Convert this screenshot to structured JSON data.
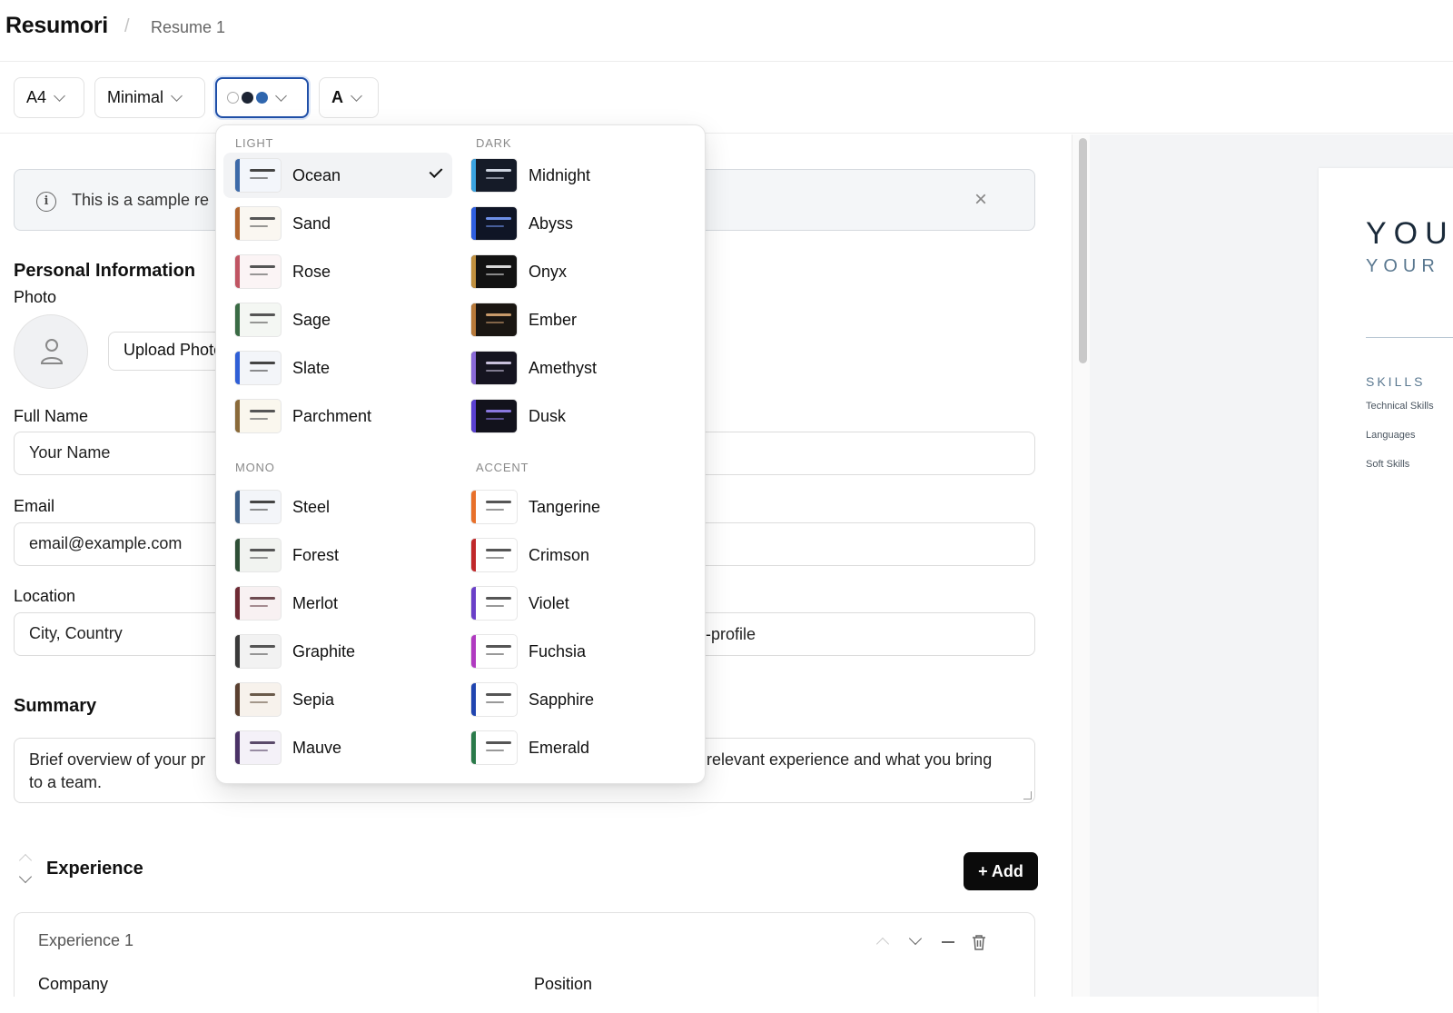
{
  "app": {
    "brand": "Resumori",
    "separator": "/",
    "breadcrumb": "Resume 1"
  },
  "toolbar": {
    "page_size": "A4",
    "template": "Minimal",
    "font_label": "A",
    "color_dots": [
      "#ffffff",
      "#1c2433",
      "#2f66ae"
    ]
  },
  "banner": {
    "text": "This is a sample re",
    "close": "×"
  },
  "personal": {
    "heading": "Personal Information",
    "photo_label": "Photo",
    "upload_label": "Upload Photo",
    "full_name_label": "Full Name",
    "full_name_placeholder": "Your Name",
    "email_label": "Email",
    "email_placeholder": "email@example.com",
    "location_label": "Location",
    "location_placeholder": "City, Country",
    "profile_tail": "-profile"
  },
  "summary": {
    "heading": "Summary",
    "placeholder_start": "Brief overview of your pr",
    "placeholder_end": "relevant experience and what you bring",
    "placeholder_line2": "to a team."
  },
  "experience": {
    "heading": "Experience",
    "add_label": "+ Add",
    "card_title": "Experience 1",
    "company_label": "Company",
    "position_label": "Position"
  },
  "preview": {
    "name": "YOU",
    "subtitle": "YOUR",
    "skills_heading": "SKILLS",
    "skill_items": [
      "Technical Skills",
      "Languages",
      "Soft Skills"
    ]
  },
  "themes": {
    "groups": {
      "light": "LIGHT",
      "dark": "DARK",
      "mono": "MONO",
      "accent": "ACCENT"
    },
    "selected": "Ocean",
    "light": [
      {
        "name": "Ocean",
        "bar": "#3d6aa8",
        "bg": "#f3f6fb",
        "line": "#444444"
      },
      {
        "name": "Sand",
        "bar": "#b0652f",
        "bg": "#faf7f1",
        "line": "#555555"
      },
      {
        "name": "Rose",
        "bar": "#c05563",
        "bg": "#fbf4f5",
        "line": "#555555"
      },
      {
        "name": "Sage",
        "bar": "#3a6b45",
        "bg": "#f4f7f3",
        "line": "#555555"
      },
      {
        "name": "Slate",
        "bar": "#2f5fd6",
        "bg": "#f3f5f9",
        "line": "#444444"
      },
      {
        "name": "Parchment",
        "bar": "#8a6a3a",
        "bg": "#faf7ee",
        "line": "#555555"
      }
    ],
    "dark": [
      {
        "name": "Midnight",
        "bar": "#3aa3e0",
        "bg": "#151b28",
        "line": "#cfd6e2"
      },
      {
        "name": "Abyss",
        "bar": "#2f5fe0",
        "bg": "#0f1526",
        "line": "#6d8fe8"
      },
      {
        "name": "Onyx",
        "bar": "#c0903f",
        "bg": "#121212",
        "line": "#d8d8d8"
      },
      {
        "name": "Ember",
        "bar": "#b87a3a",
        "bg": "#1a1612",
        "line": "#c89a6a"
      },
      {
        "name": "Amethyst",
        "bar": "#8a6ad8",
        "bg": "#151420",
        "line": "#c8c0dc"
      },
      {
        "name": "Dusk",
        "bar": "#5a40d0",
        "bg": "#12121c",
        "line": "#8a78e0"
      }
    ],
    "mono": [
      {
        "name": "Steel",
        "bar": "#3d5f88",
        "bg": "#f3f5f9",
        "line": "#444444"
      },
      {
        "name": "Forest",
        "bar": "#2e4f36",
        "bg": "#f1f3f0",
        "line": "#555555"
      },
      {
        "name": "Merlot",
        "bar": "#6e2a34",
        "bg": "#f8f1f2",
        "line": "#6e4a50"
      },
      {
        "name": "Graphite",
        "bar": "#3a3a3a",
        "bg": "#f2f2f2",
        "line": "#555555"
      },
      {
        "name": "Sepia",
        "bar": "#5a4030",
        "bg": "#f7f2ec",
        "line": "#6a5a4a"
      },
      {
        "name": "Mauve",
        "bar": "#4a3266",
        "bg": "#f4f1f8",
        "line": "#5a4a6a"
      }
    ],
    "accent": [
      {
        "name": "Tangerine",
        "bar": "#e8702a",
        "bg": "#ffffff",
        "line": "#555555"
      },
      {
        "name": "Crimson",
        "bar": "#c0282a",
        "bg": "#ffffff",
        "line": "#555555"
      },
      {
        "name": "Violet",
        "bar": "#6a40c8",
        "bg": "#ffffff",
        "line": "#555555"
      },
      {
        "name": "Fuchsia",
        "bar": "#b03ac0",
        "bg": "#ffffff",
        "line": "#555555"
      },
      {
        "name": "Sapphire",
        "bar": "#2045b0",
        "bg": "#ffffff",
        "line": "#555555"
      },
      {
        "name": "Emerald",
        "bar": "#2a7a4a",
        "bg": "#ffffff",
        "line": "#555555"
      }
    ]
  }
}
